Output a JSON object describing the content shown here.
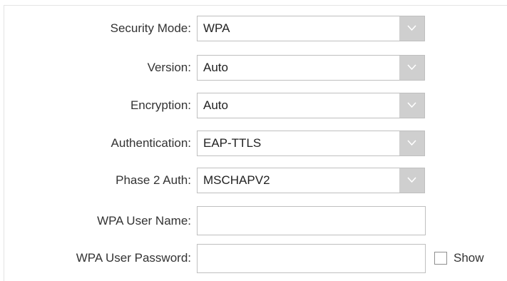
{
  "form": {
    "security_mode": {
      "label": "Security Mode:",
      "value": "WPA"
    },
    "version": {
      "label": "Version:",
      "value": "Auto"
    },
    "encryption": {
      "label": "Encryption:",
      "value": "Auto"
    },
    "authentication": {
      "label": "Authentication:",
      "value": "EAP-TTLS"
    },
    "phase2_auth": {
      "label": "Phase 2 Auth:",
      "value": "MSCHAPV2"
    },
    "wpa_user_name": {
      "label": "WPA User Name:",
      "value": "",
      "placeholder": ""
    },
    "wpa_user_password": {
      "label": "WPA User Password:",
      "value": "",
      "placeholder": ""
    },
    "show_password": {
      "label": "Show",
      "checked": false
    }
  },
  "icons": {
    "dropdown": "chevron-down-icon"
  },
  "colors": {
    "dropdown_button": "#cfcfcf",
    "border": "#bfbfbf",
    "text": "#333333"
  }
}
